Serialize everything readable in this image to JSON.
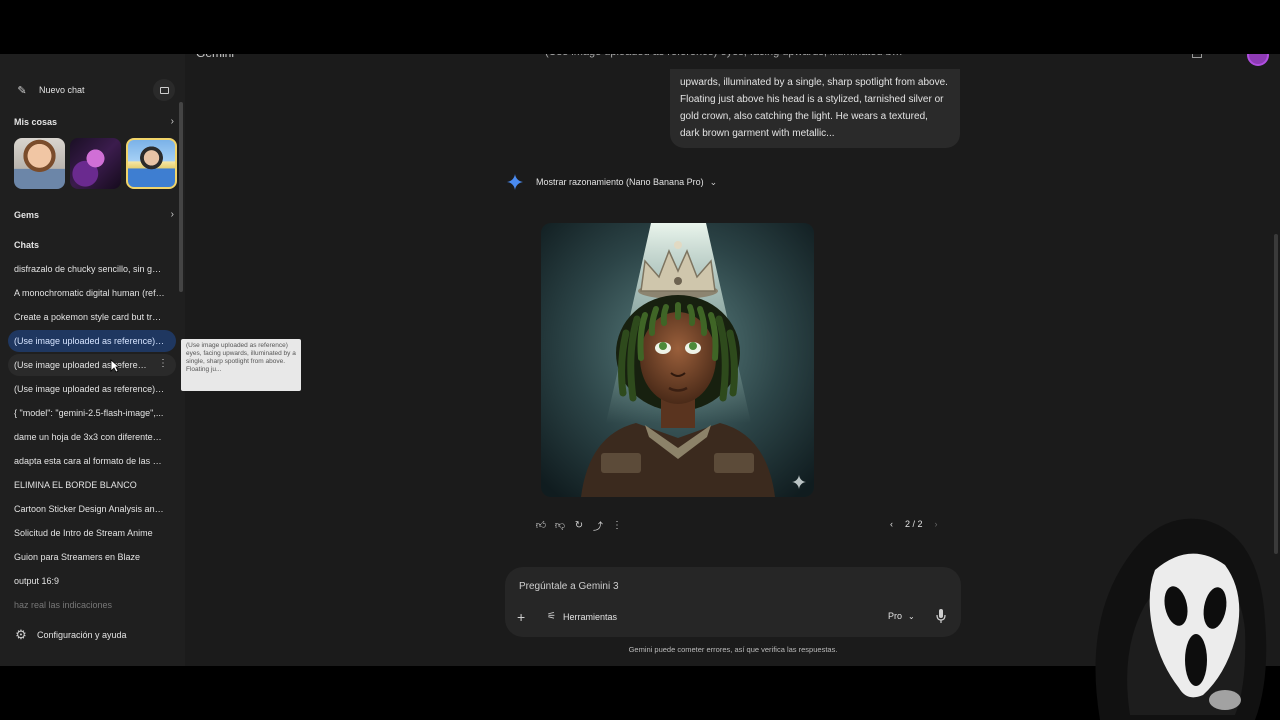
{
  "topbar": {
    "brand": "Gemini",
    "conversation_title": "(Use image uploaded as reference) eyes, facing upwards, illuminated by a si..."
  },
  "sidebar": {
    "new_chat_label": "Nuevo chat",
    "my_things_label": "Mis cosas",
    "gems_label": "Gems",
    "chats_label": "Chats",
    "chats": [
      "disfrazalo de chucky sencillo, sin gaf...",
      " A monochromatic digital human (refe...",
      "Create a pokemon style card but trad...",
      "(Use image uploaded as reference) e...",
      "(Use image uploaded as referen...",
      "(Use image uploaded as reference) e...",
      "{   \"model\": \"gemini-2.5-flash-image\",...",
      "dame un hoja de 3x3 con diferentes e...",
      "adapta esta cara al formato de las ca...",
      "ELIMINA EL BORDE BLANCO",
      "Cartoon Sticker Design Analysis and ...",
      "Solicitud de Intro de Stream Anime",
      "Guion para Streamers en Blaze",
      "output 16:9",
      "haz real las indicaciones"
    ],
    "tooltip": "(Use image uploaded as reference) eyes, facing upwards, illuminated by a single, sharp spotlight from above. Floating ju...",
    "settings_label": "Configuración y ayuda"
  },
  "conversation": {
    "user_message": "upwards, illuminated by a single, sharp spotlight from above. Floating just above his head is a stylized, tarnished silver or gold crown, also catching the light. He wears a textured, dark brown garment with metallic...",
    "reasoning_label": "Mostrar razonamiento (Nano Banana Pro)",
    "pager": "2 / 2"
  },
  "composer": {
    "placeholder": "Pregúntale a Gemini 3",
    "tools_label": "Herramientas",
    "model_label": "Pro"
  },
  "disclaimer": "Gemini puede cometer errores, así que verifica las respuestas.",
  "colors": {
    "app_bg": "#1b1b1b",
    "sidebar_bg": "#1f1f1f",
    "active_chat": "#1f3760",
    "accent_avatar": "#8e3bb5"
  }
}
